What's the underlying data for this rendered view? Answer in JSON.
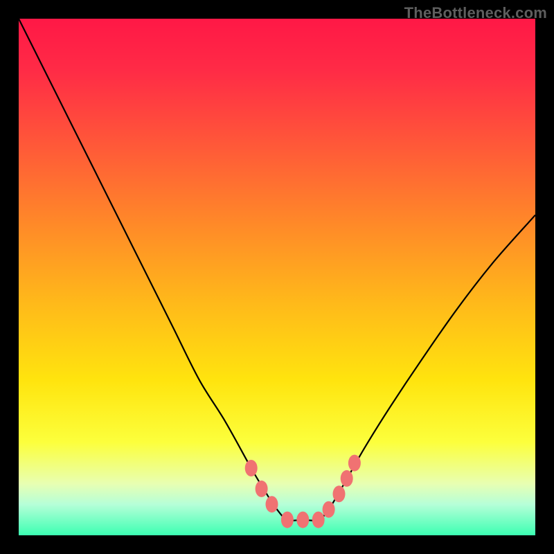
{
  "watermark": "TheBottleneck.com",
  "colors": {
    "frame": "#000000",
    "marker": "#f07272",
    "curve": "#000000",
    "gradient_top": "#ff1846",
    "gradient_bottom": "#3cffb2"
  },
  "chart_data": {
    "type": "line",
    "title": "",
    "xlabel": "",
    "ylabel": "",
    "xlim": [
      0,
      100
    ],
    "ylim": [
      0,
      100
    ],
    "series": [
      {
        "name": "bottleneck-curve",
        "x": [
          0,
          5,
          10,
          15,
          20,
          25,
          30,
          35,
          40,
          45,
          48,
          50,
          52,
          55,
          58,
          60,
          63,
          67,
          72,
          78,
          85,
          92,
          100
        ],
        "values": [
          100,
          90,
          80,
          70,
          60,
          50,
          40,
          30,
          22,
          13,
          8,
          5,
          3,
          3,
          3,
          5,
          10,
          17,
          25,
          34,
          44,
          53,
          62
        ]
      }
    ],
    "markers": [
      {
        "x": 45,
        "y": 13
      },
      {
        "x": 47,
        "y": 9
      },
      {
        "x": 49,
        "y": 6
      },
      {
        "x": 52,
        "y": 3
      },
      {
        "x": 55,
        "y": 3
      },
      {
        "x": 58,
        "y": 3
      },
      {
        "x": 60,
        "y": 5
      },
      {
        "x": 62,
        "y": 8
      },
      {
        "x": 63.5,
        "y": 11
      },
      {
        "x": 65,
        "y": 14
      }
    ]
  }
}
